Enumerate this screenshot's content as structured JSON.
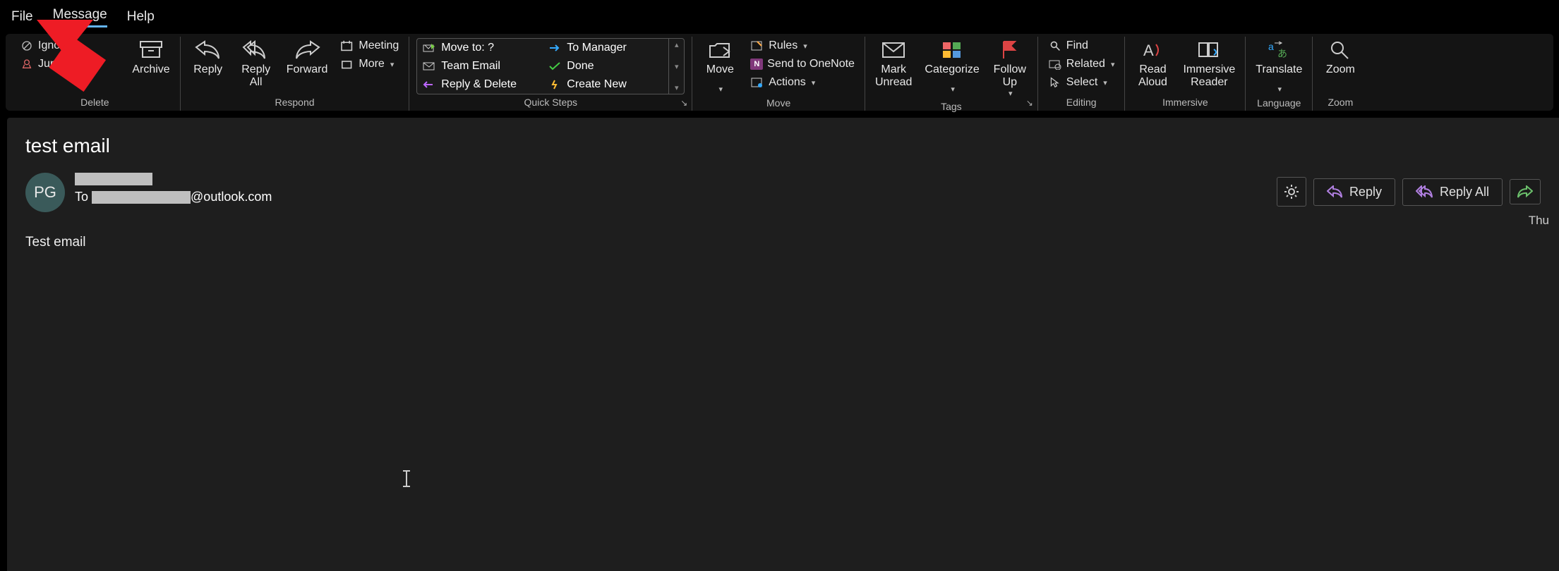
{
  "menubar": {
    "file": "File",
    "message": "Message",
    "help": "Help"
  },
  "ribbon": {
    "delete": {
      "label": "Delete",
      "ignore": "Ignore",
      "junk": "Junk",
      "archive": "Archive"
    },
    "respond": {
      "label": "Respond",
      "reply": "Reply",
      "replyall": "Reply\nAll",
      "forward": "Forward",
      "meeting": "Meeting",
      "more": "More"
    },
    "quicksteps": {
      "label": "Quick Steps",
      "items": [
        "Move to: ?",
        "To Manager",
        "Team Email",
        "Done",
        "Reply & Delete",
        "Create New"
      ]
    },
    "move": {
      "label": "Move",
      "move": "Move",
      "rules": "Rules",
      "onenote": "Send to OneNote",
      "actions": "Actions"
    },
    "tags": {
      "label": "Tags",
      "markunread": "Mark\nUnread",
      "categorize": "Categorize",
      "followup": "Follow\nUp"
    },
    "editing": {
      "label": "Editing",
      "find": "Find",
      "related": "Related",
      "select": "Select"
    },
    "immersive": {
      "label": "Immersive",
      "readaloud": "Read\nAloud",
      "reader": "Immersive\nReader"
    },
    "language": {
      "label": "Language",
      "translate": "Translate"
    },
    "zoom": {
      "label": "Zoom",
      "zoom": "Zoom"
    }
  },
  "email": {
    "subject": "test email",
    "avatar_initials": "PG",
    "to_label": "To",
    "to_suffix": "@outlook.com",
    "timestamp": "Thu",
    "body": "Test email",
    "actions": {
      "reply": "Reply",
      "replyall": "Reply All"
    }
  }
}
